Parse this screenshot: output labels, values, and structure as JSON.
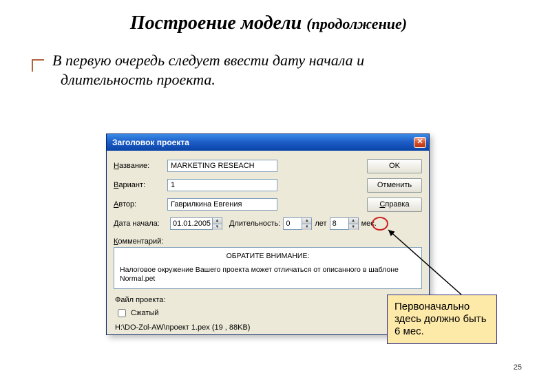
{
  "title_main": "Построение модели ",
  "title_sub": "(продолжение)",
  "intro_line1": "В  первую очередь следует ввести дату начала и",
  "intro_line2": "длительность проекта.",
  "dialog": {
    "title": "Заголовок проекта",
    "ok": "OK",
    "cancel": "Отменить",
    "help_pre": "С",
    "help_rest": "правка",
    "labels": {
      "name": "Название:",
      "variant": "Вариант:",
      "author": "Автор:",
      "date": "Дата начала:",
      "duration": "Длительность:",
      "years": "лет",
      "months": "мес.",
      "comment": "Комментарий:",
      "file_group": "Файл проекта:",
      "compressed": "Сжатый"
    },
    "fields": {
      "name": "MARKETING RESEACH",
      "variant": "1",
      "author": "Гаврилкина Евгения",
      "date": "01.01.2005",
      "years": "0",
      "months": "8"
    },
    "notice_header": "ОБРАТИТЕ ВНИМАНИЕ:",
    "notice_body": "Налоговое окружение Вашего проекта может отличаться от описанного в шаблоне Normal.pet",
    "path": "H:\\DO-Zol-AW\\проект 1.pex (19 , 88KB)"
  },
  "annotation": "Первоначально здесь должно быть 6 мес.",
  "slide_number": "25"
}
